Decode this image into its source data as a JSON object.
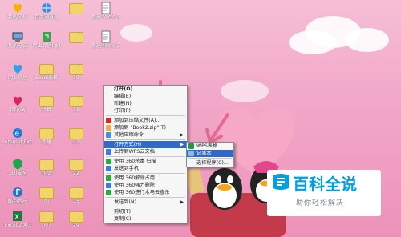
{
  "desktop": {
    "icons": [
      {
        "label": "我的文档",
        "type": "heart-gold"
      },
      {
        "label": "百度浏览器",
        "type": "globe"
      },
      {
        "label": "",
        "type": "folder"
      },
      {
        "label": "新建 Micro 文档",
        "type": "doc"
      },
      {
        "label": "我的电脑",
        "type": "computer"
      },
      {
        "label": "网上邻居(本)",
        "type": "network"
      },
      {
        "label": "",
        "type": "folder"
      },
      {
        "label": "新建 Micro 文档",
        "type": "doc"
      },
      {
        "label": "网上邻居",
        "type": "heart-blue"
      },
      {
        "label": "Excel表格",
        "type": "folder"
      },
      {
        "label": "10",
        "type": "folder"
      },
      {
        "label": "回收站",
        "type": "heart-red"
      },
      {
        "label": "计算",
        "type": "folder"
      },
      {
        "label": "11",
        "type": "folder"
      },
      {
        "label": "Internet Explorer",
        "type": "ie"
      },
      {
        "label": "新建",
        "type": "folder"
      },
      {
        "label": "21",
        "type": "folder"
      },
      {
        "label": "360安全",
        "type": "shield"
      },
      {
        "label": "作品",
        "type": "folder"
      },
      {
        "label": "22",
        "type": "folder"
      },
      {
        "label": "酷狗音乐",
        "type": "music"
      },
      {
        "label": "图",
        "type": "folder"
      },
      {
        "label": "25",
        "type": "folder"
      },
      {
        "label": "Excel 2003",
        "type": "excel"
      },
      {
        "label": "007",
        "type": "folder"
      },
      {
        "label": "29",
        "type": "folder"
      }
    ]
  },
  "context_menu": {
    "items": [
      {
        "label": "打开(O)",
        "bold": true
      },
      {
        "label": "编辑(E)"
      },
      {
        "label": "新建(N)"
      },
      {
        "label": "打印(P)"
      },
      {
        "sep": true
      },
      {
        "label": "添加到压缩文件(A)..."
      },
      {
        "label": "添加到 \"Book2.zip\"(T)"
      },
      {
        "label": "其他压缩命令",
        "arrow": true
      },
      {
        "sep": true
      },
      {
        "label": "打开方式(H)",
        "arrow": true,
        "highlight": true
      },
      {
        "label": "上传到WPS云文档"
      },
      {
        "sep": true
      },
      {
        "label": "使用 360杀毒 扫描"
      },
      {
        "label": "发送到手机"
      },
      {
        "sep": true
      },
      {
        "label": "使用 360解除占用"
      },
      {
        "label": "使用 360强力删除"
      },
      {
        "label": "使用 360进行木马云查杀"
      },
      {
        "sep": true
      },
      {
        "label": "发送到(N)",
        "arrow": true
      },
      {
        "sep": true
      },
      {
        "label": "剪切(T)"
      },
      {
        "label": "复制(C)"
      }
    ]
  },
  "submenu": {
    "items": [
      {
        "label": "WPS表格"
      },
      {
        "label": "记事本",
        "highlight": true
      },
      {
        "sep": true
      },
      {
        "label": "选择程序(C)..."
      }
    ]
  },
  "watermark": {
    "title": "百科全说",
    "subtitle": "助你轻松解决"
  },
  "colors": {
    "menu_highlight": "#316ac5",
    "arrow": "#e06c8f",
    "brand_blue": "#00a0e0"
  }
}
